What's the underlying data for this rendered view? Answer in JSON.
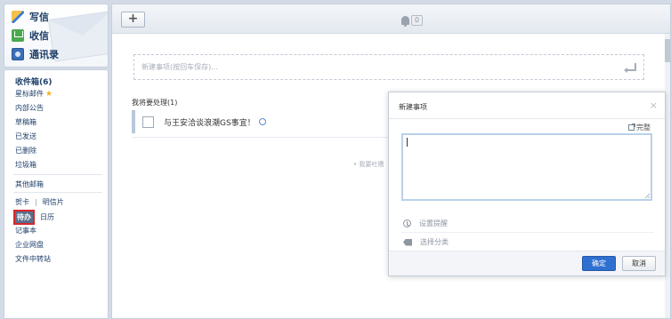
{
  "sidebar": {
    "top": [
      {
        "label": "写信",
        "icon": "write-icon"
      },
      {
        "label": "收信",
        "icon": "inbox-icon"
      },
      {
        "label": "通讯录",
        "icon": "contacts-icon"
      }
    ],
    "folders": {
      "inbox": "收件箱(6)",
      "starred": "星标邮件",
      "internal": "内部公告",
      "drafts": "草稿箱",
      "sent": "已发送",
      "deleted": "已删除",
      "junk": "垃圾箱"
    },
    "other_mail": "其他邮箱",
    "cards": "贺卡",
    "postcards": "明信片",
    "todo": "待办",
    "calendar": "日历",
    "notes": "记事本",
    "netdisk": "企业网盘",
    "transfer": "文件中转站"
  },
  "toolbar": {
    "add_label": "+",
    "reminder_count": "0"
  },
  "main": {
    "new_placeholder": "新建事项(按回车保存)...",
    "list_title": "我将要处理(1)",
    "tasks": [
      {
        "text": "与王安洽谈浪潮GS事宜！"
      }
    ],
    "bg_hint": "• 我要吐槽"
  },
  "dialog": {
    "title": "新建事项",
    "close": "×",
    "full_label": "完整",
    "textarea_value": "",
    "set_reminder": "设置提醒",
    "select_category": "选择分类",
    "ok": "确定",
    "cancel": "取消"
  },
  "colors": {
    "accent": "#2f6fd0",
    "active_highlight": "#d8262b",
    "nav_text": "#1f3f6a"
  }
}
